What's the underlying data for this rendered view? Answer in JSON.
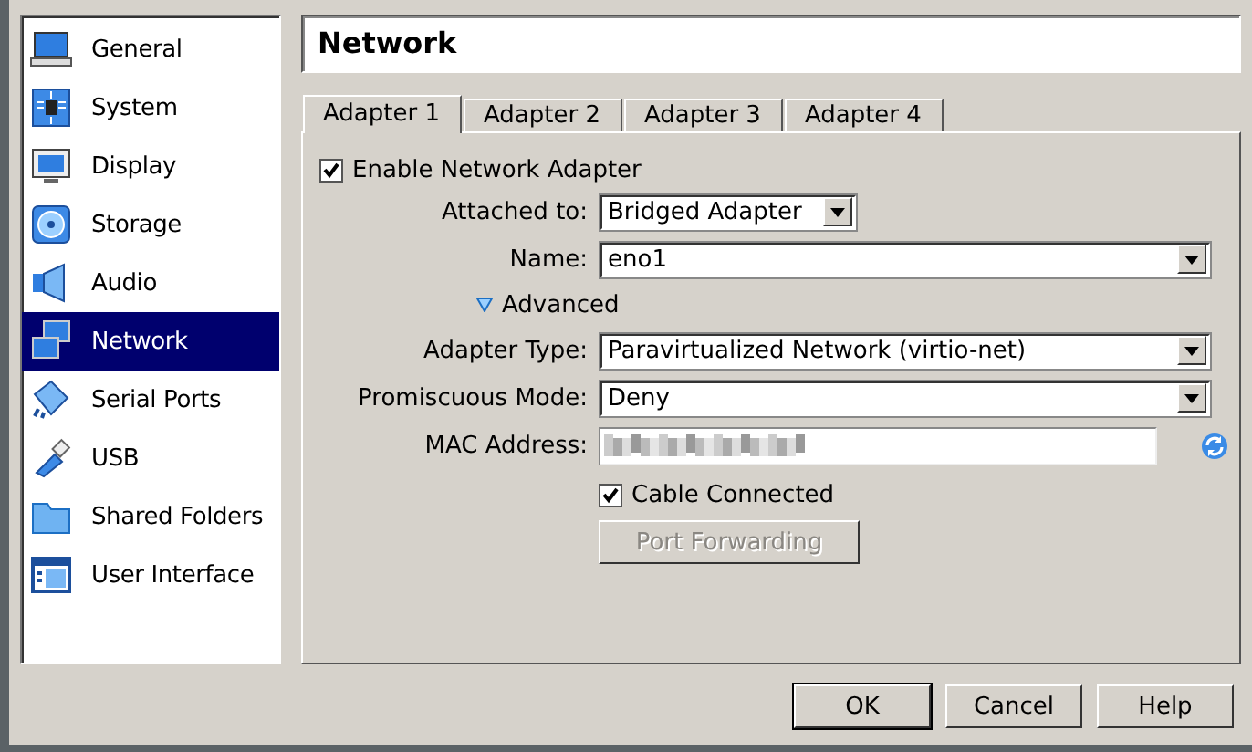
{
  "sidebar": {
    "items": [
      {
        "label": "General",
        "kind": "general",
        "selected": false
      },
      {
        "label": "System",
        "kind": "system",
        "selected": false
      },
      {
        "label": "Display",
        "kind": "display",
        "selected": false
      },
      {
        "label": "Storage",
        "kind": "storage",
        "selected": false
      },
      {
        "label": "Audio",
        "kind": "audio",
        "selected": false
      },
      {
        "label": "Network",
        "kind": "network",
        "selected": true
      },
      {
        "label": "Serial Ports",
        "kind": "serial",
        "selected": false
      },
      {
        "label": "USB",
        "kind": "usb",
        "selected": false
      },
      {
        "label": "Shared Folders",
        "kind": "folder",
        "selected": false
      },
      {
        "label": "User Interface",
        "kind": "ui",
        "selected": false
      }
    ]
  },
  "page_title": "Network",
  "tabs": [
    {
      "label": "Adapter 1",
      "selected": true
    },
    {
      "label": "Adapter 2",
      "selected": false
    },
    {
      "label": "Adapter 3",
      "selected": false
    },
    {
      "label": "Adapter 4",
      "selected": false
    }
  ],
  "enable_adapter": {
    "label": "Enable Network Adapter",
    "checked": true
  },
  "attached_to": {
    "label": "Attached to:",
    "value": "Bridged Adapter"
  },
  "name": {
    "label": "Name:",
    "value": "eno1"
  },
  "advanced": {
    "label": "Advanced",
    "expanded": true
  },
  "adapter_type": {
    "label": "Adapter Type:",
    "value": "Paravirtualized Network (virtio-net)"
  },
  "promiscuous_mode": {
    "label": "Promiscuous Mode:",
    "value": "Deny"
  },
  "mac_address": {
    "label": "MAC Address:",
    "redacted": true
  },
  "cable_connected": {
    "label": "Cable Connected",
    "checked": true
  },
  "port_forwarding": {
    "label": "Port Forwarding",
    "disabled": true
  },
  "buttons": [
    {
      "label": "OK",
      "default": true
    },
    {
      "label": "Cancel",
      "default": false
    },
    {
      "label": "Help",
      "default": false
    }
  ]
}
